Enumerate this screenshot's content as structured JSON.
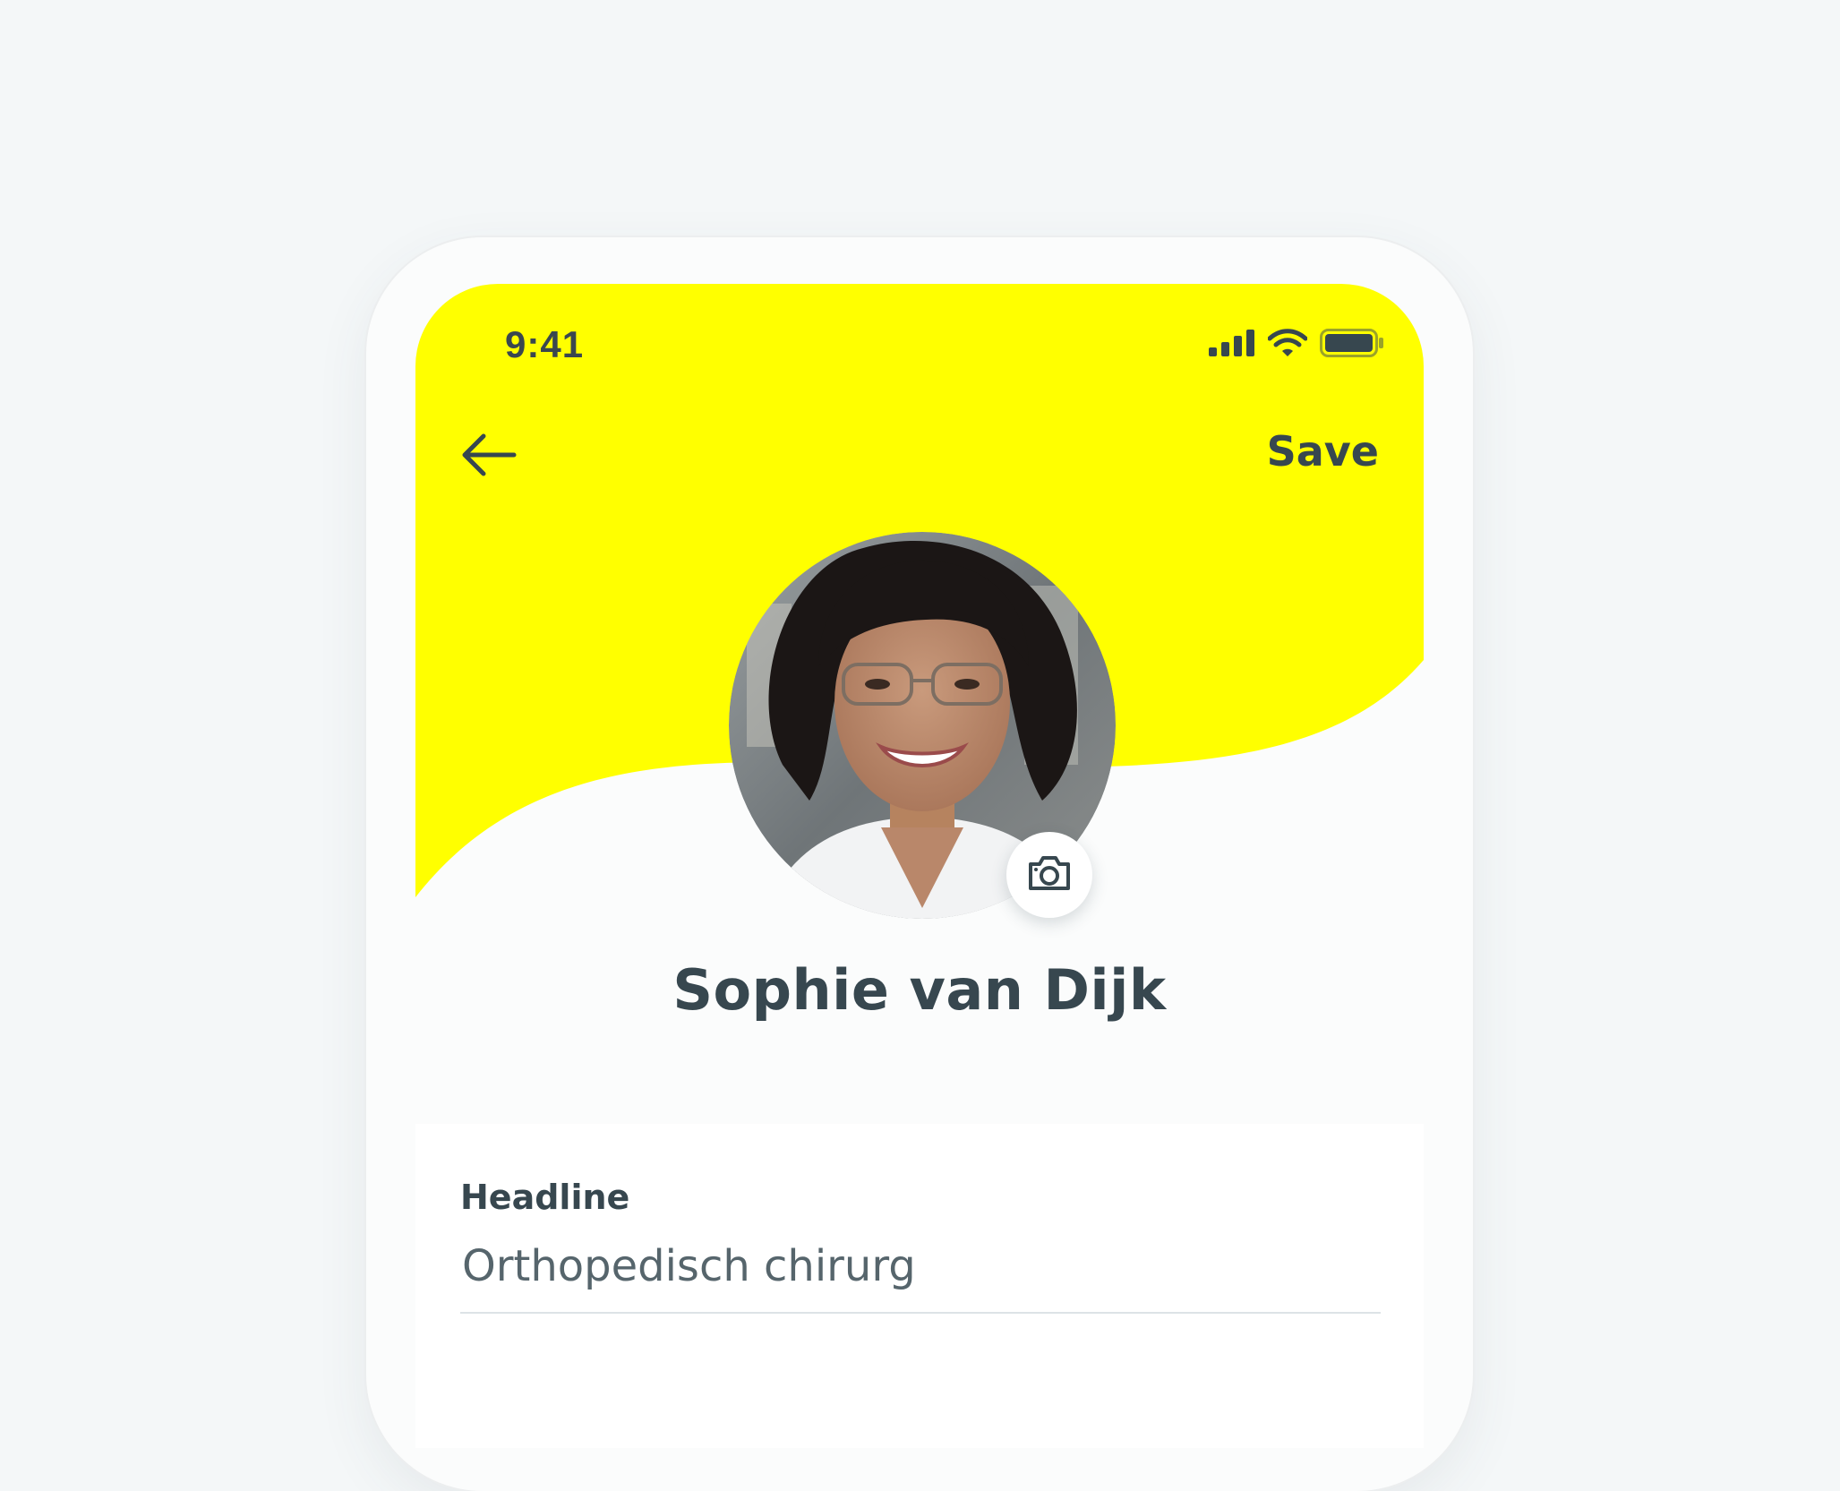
{
  "status_bar": {
    "time": "9:41",
    "icons": [
      "signal-icon",
      "wifi-icon",
      "battery-icon"
    ]
  },
  "nav": {
    "back_icon": "arrow-left-icon",
    "save_label": "Save"
  },
  "profile": {
    "name": "Sophie van Dijk",
    "avatar_icon": "profile-photo",
    "camera_icon": "camera-icon"
  },
  "form": {
    "headline_label": "Headline",
    "headline_value": "Orthopedisch chirurg"
  },
  "colors": {
    "accent": "#ffff00",
    "text_primary": "#37474f",
    "text_secondary": "#56656c",
    "background": "#f4f7f8"
  }
}
